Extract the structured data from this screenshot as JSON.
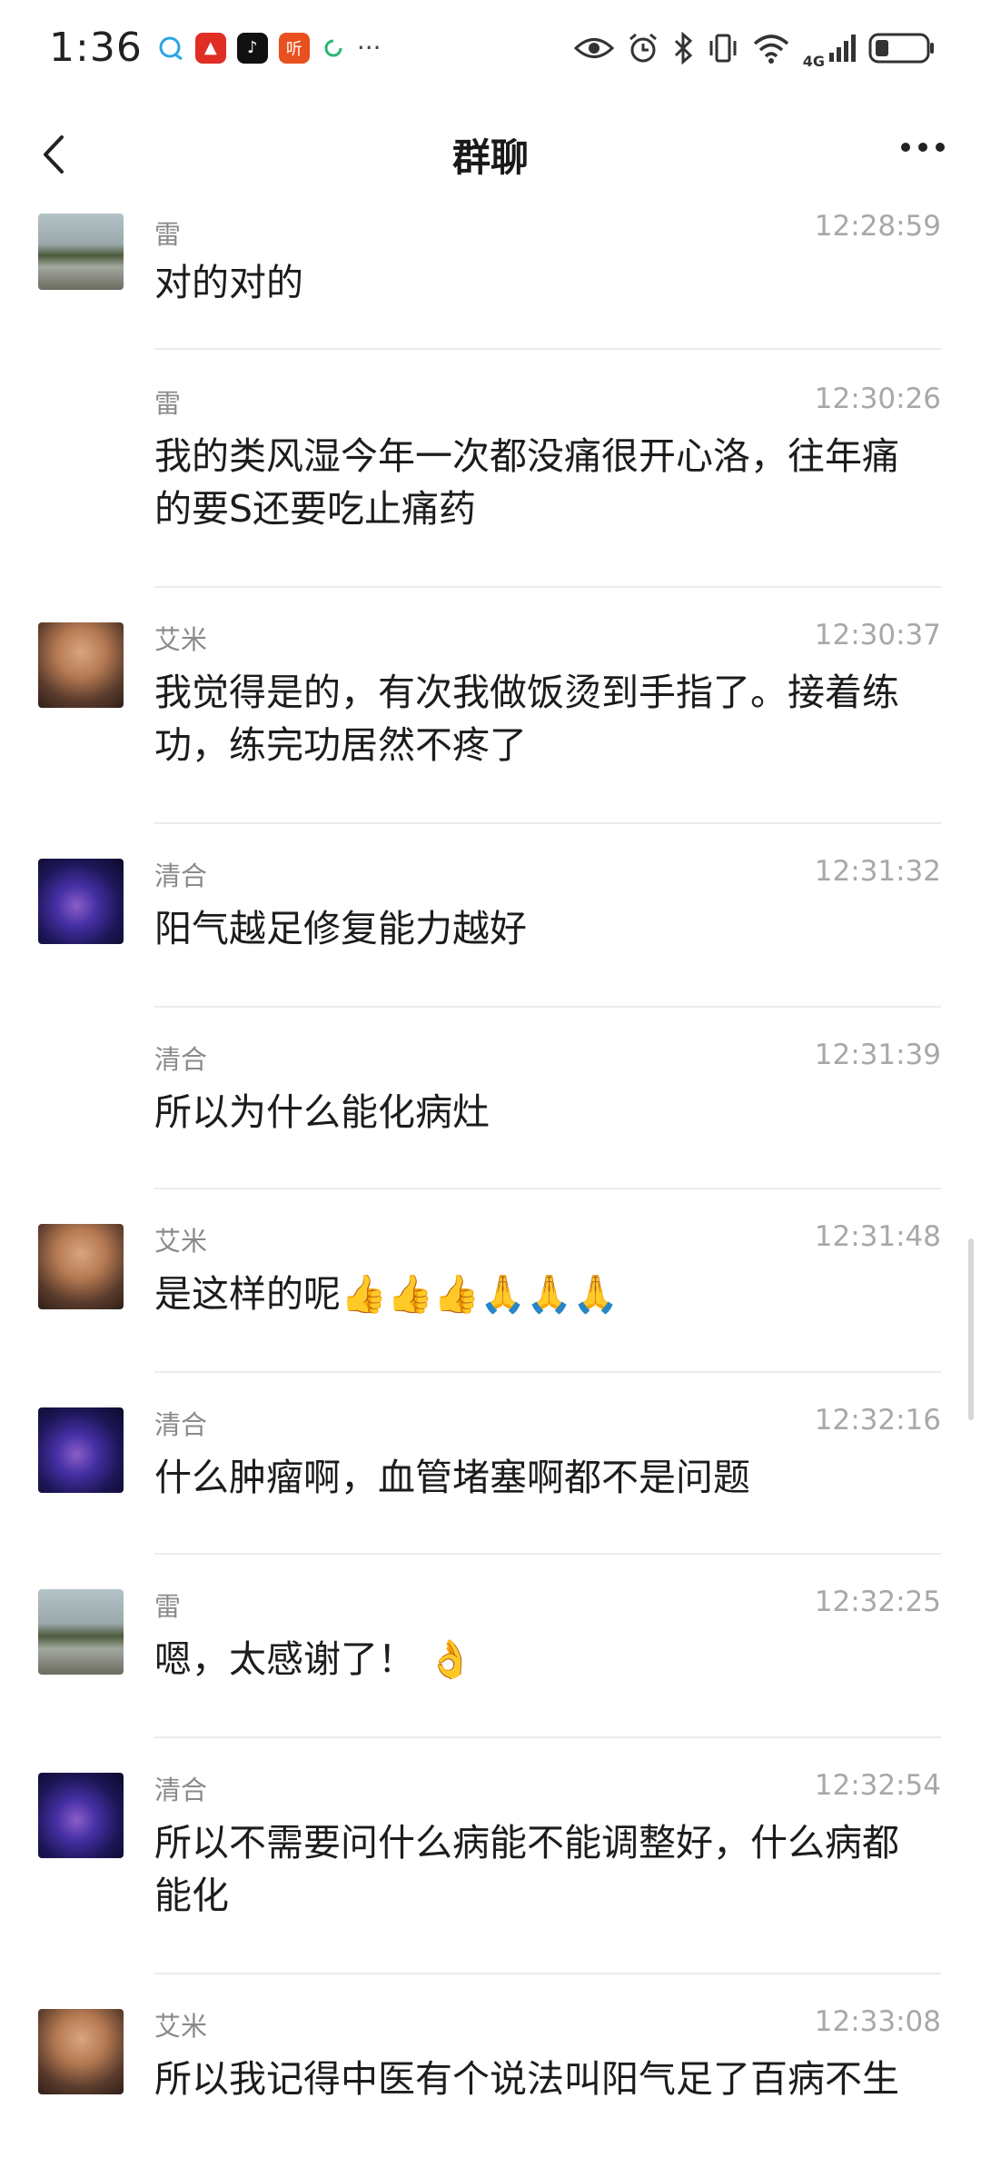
{
  "status_bar": {
    "time": "1:36",
    "network": "4G",
    "apps": [
      {
        "name": "chat-bubble-icon",
        "color": "#2aa5e6"
      },
      {
        "name": "pinduoduo-icon",
        "color": "#e02e24"
      },
      {
        "name": "tiktok-icon",
        "color": "#111111"
      },
      {
        "name": "ting-icon",
        "color": "#e8501f",
        "label": "听"
      },
      {
        "name": "refresh-icon",
        "color": "#2cb673"
      }
    ],
    "more": "···"
  },
  "nav": {
    "title": "群聊"
  },
  "messages": [
    {
      "sender": "雷",
      "time": "12:28:59",
      "text": "对的对的",
      "avatar": "lake"
    },
    {
      "sender": "雷",
      "time": "12:30:26",
      "text": "我的类风湿今年一次都没痛很开心洛，往年痛的要S还要吃止痛药",
      "avatar": ""
    },
    {
      "sender": "艾米",
      "time": "12:30:37",
      "text": "我觉得是的，有次我做饭烫到手指了。接着练功，练完功居然不疼了",
      "avatar": "woman"
    },
    {
      "sender": "清合",
      "time": "12:31:32",
      "text": "阳气越足修复能力越好",
      "avatar": "planet"
    },
    {
      "sender": "清合",
      "time": "12:31:39",
      "text": "所以为什么能化病灶",
      "avatar": ""
    },
    {
      "sender": "艾米",
      "time": "12:31:48",
      "text": "是这样的呢👍👍👍🙏🙏🙏",
      "avatar": "woman"
    },
    {
      "sender": "清合",
      "time": "12:32:16",
      "text": "什么肿瘤啊，血管堵塞啊都不是问题",
      "avatar": "planet"
    },
    {
      "sender": "雷",
      "time": "12:32:25",
      "text": "嗯，太感谢了！ 👌",
      "avatar": "lake"
    },
    {
      "sender": "清合",
      "time": "12:32:54",
      "text": "所以不需要问什么病能不能调整好，什么病都能化",
      "avatar": "planet"
    },
    {
      "sender": "艾米",
      "time": "12:33:08",
      "text": "所以我记得中医有个说法叫阳气足了百病不生",
      "avatar": "woman"
    }
  ]
}
